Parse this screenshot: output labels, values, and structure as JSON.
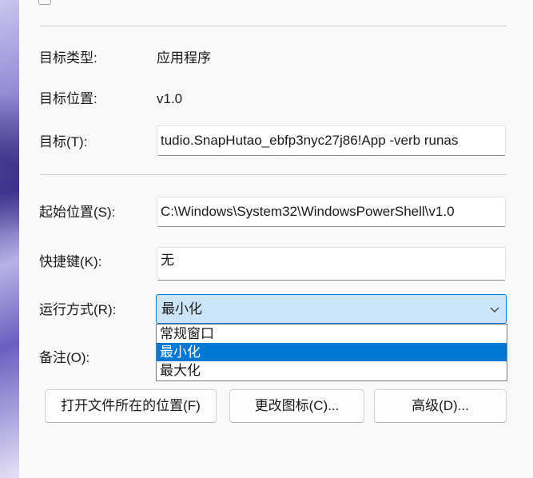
{
  "properties": {
    "target_type_label": "目标类型:",
    "target_type_value": "应用程序",
    "target_location_label": "目标位置:",
    "target_location_value": "v1.0",
    "target_label": "目标(T):",
    "target_value": "tudio.SnapHutao_ebfp3nyc27j86!App -verb runas",
    "start_in_label": "起始位置(S):",
    "start_in_value": "C:\\Windows\\System32\\WindowsPowerShell\\v1.0",
    "shortcut_key_label": "快捷键(K):",
    "shortcut_key_value": "无",
    "run_label": "运行方式(R):",
    "run_selected": "最小化",
    "run_options": [
      "常规窗口",
      "最小化",
      "最大化"
    ],
    "comment_label": "备注(O):"
  },
  "buttons": {
    "open_location": "打开文件所在的位置(F)",
    "change_icon": "更改图标(C)...",
    "advanced": "高级(D)..."
  },
  "icons": {
    "combo_arrow": "chevron-down-icon"
  },
  "colors": {
    "selection": "#0078d4",
    "combo_background": "#cce4f7"
  }
}
